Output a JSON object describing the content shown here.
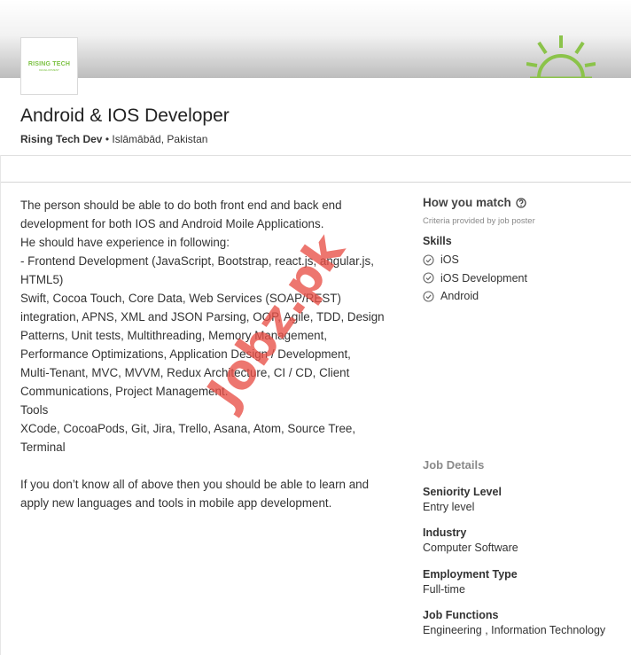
{
  "company_logo": {
    "text": "RISING TECH",
    "subtext": "DEVELOPMENT"
  },
  "header": {
    "title": "Android & IOS Developer",
    "company": "Rising Tech Dev",
    "separator": "•",
    "location": "Islāmābād, Pakistan"
  },
  "description": {
    "lines": [
      "The person should be able to do both front end and back end",
      "development for both IOS and Android Moile Applications.",
      "He should have experience in following:",
      "- Frontend Development (JavaScript, Bootstrap, react.js, angular.js,",
      "HTML5)",
      "Swift, Cocoa Touch, Core Data, Web Services (SOAP/REST)",
      "integration, APNS, XML and JSON Parsing, OOP, Agile, TDD, Design",
      "Patterns, Unit tests, Multithreading, Memory Management,",
      "Performance Optimizations, Application Design / Development,",
      "Multi-Tenant, MVC, MVVM, Redux Architecture, CI / CD, Client",
      "Communications, Project Management.",
      "Tools",
      "XCode, CocoaPods, Git, Jira, Trello, Asana, Atom, Source Tree,",
      "Terminal"
    ],
    "closing_lines": [
      "If you don’t know all of above then you should be able to learn and",
      "apply new languages and tools in mobile app development."
    ]
  },
  "match": {
    "title": "How you match",
    "help_icon": "question-circle-icon",
    "criteria": "Criteria provided by job poster",
    "skills_title": "Skills",
    "check_icon": "check-circle-icon",
    "skills": [
      "iOS",
      "iOS Development",
      "Android"
    ]
  },
  "job_details": {
    "title": "Job Details",
    "items": [
      {
        "label": "Seniority Level",
        "value": "Entry level"
      },
      {
        "label": "Industry",
        "value": "Computer Software"
      },
      {
        "label": "Employment Type",
        "value": "Full-time"
      },
      {
        "label": "Job Functions",
        "value": "Engineering , Information Technology"
      }
    ]
  },
  "watermark": "Jobz.pk",
  "colors": {
    "brand_green": "#7cc243",
    "sun_green": "#8bc34a",
    "watermark_red": "#e85046",
    "text": "#333333",
    "muted": "#8a8a8a"
  }
}
